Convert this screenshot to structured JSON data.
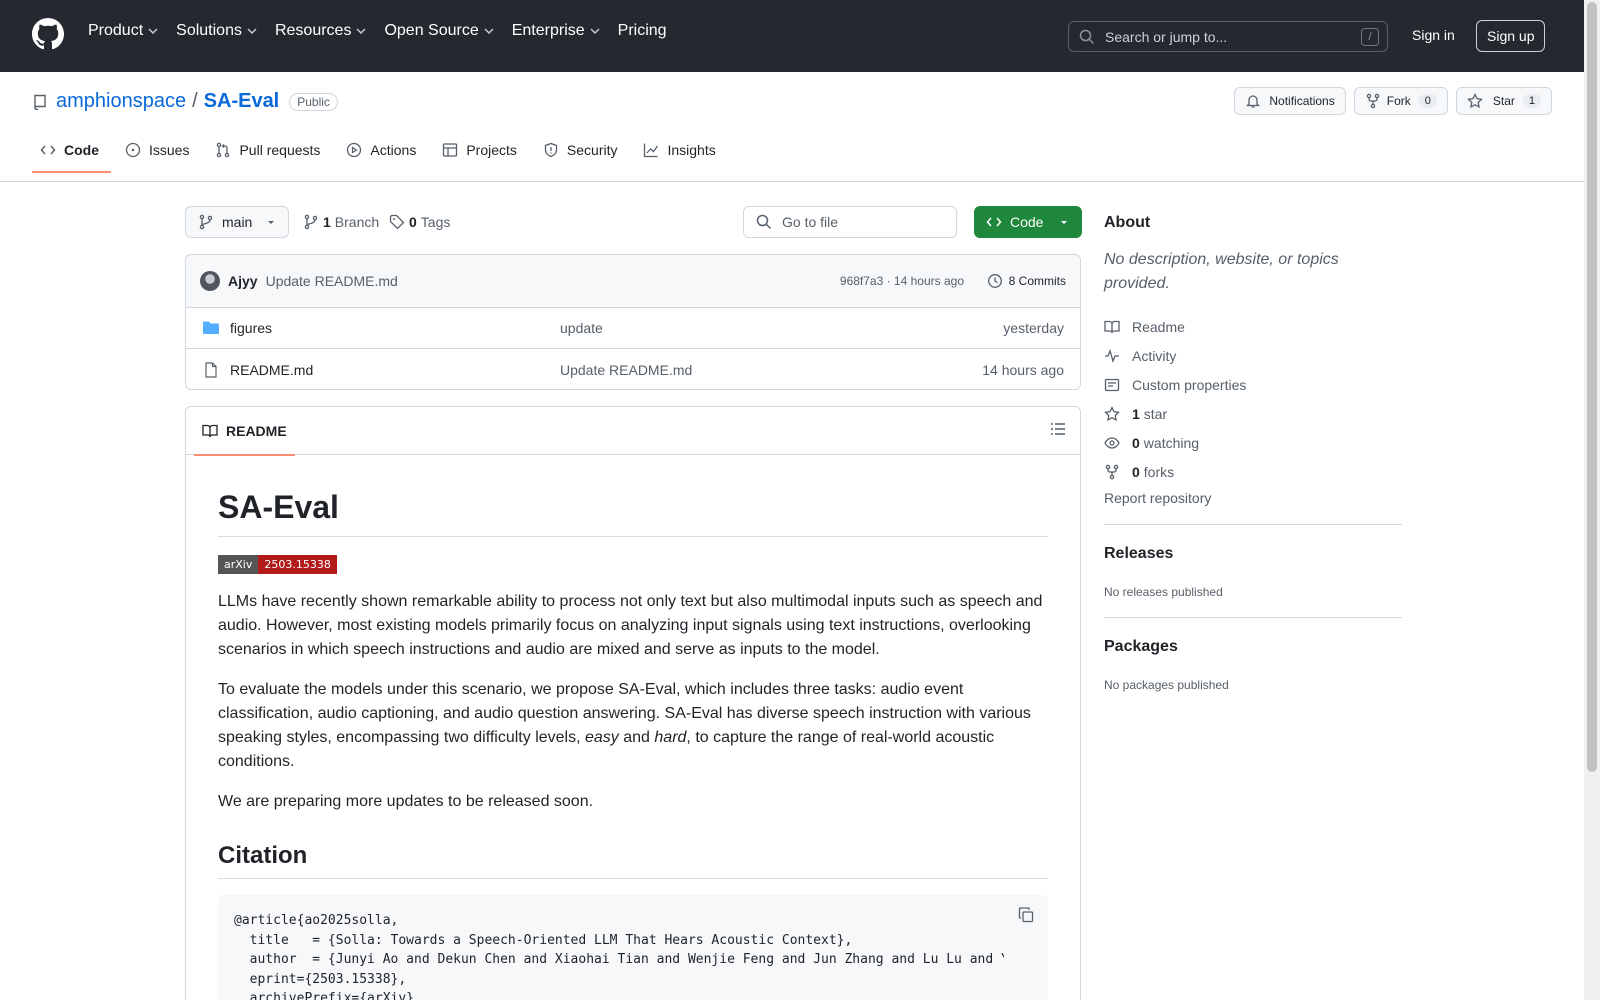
{
  "topnav": {
    "items": [
      "Product",
      "Solutions",
      "Resources",
      "Open Source",
      "Enterprise",
      "Pricing"
    ],
    "search_placeholder": "Search or jump to...",
    "search_shortcut": "/",
    "signin": "Sign in",
    "signup": "Sign up"
  },
  "repo": {
    "owner": "amphionspace",
    "separator": "/",
    "name": "SA-Eval",
    "visibility": "Public",
    "notifications_label": "Notifications",
    "fork_label": "Fork",
    "fork_count": "0",
    "star_label": "Star",
    "star_count": "1"
  },
  "tabs": [
    "Code",
    "Issues",
    "Pull requests",
    "Actions",
    "Projects",
    "Security",
    "Insights"
  ],
  "branchbar": {
    "branch": "main",
    "branch_count": "1",
    "branch_label": "Branch",
    "tag_count": "0",
    "tag_label": "Tags",
    "goto_placeholder": "Go to file",
    "code_button": "Code"
  },
  "commit": {
    "author": "Ajyy",
    "message": "Update README.md",
    "meta": "968f7a3 · 14 hours ago",
    "commits_label": "8 Commits"
  },
  "files": [
    {
      "name": "figures",
      "type": "folder",
      "message": "update",
      "date": "yesterday"
    },
    {
      "name": "README.md",
      "type": "file",
      "message": "Update README.md",
      "date": "14 hours ago"
    }
  ],
  "readme": {
    "tab_label": "README",
    "title": "SA-Eval",
    "badge_left": "arXiv",
    "badge_right": "2503.15338",
    "p1": "LLMs have recently shown remarkable ability to process not only text but also multimodal inputs such as speech and audio. However, most existing models primarily focus on analyzing input signals using text instructions, overlooking scenarios in which speech instructions and audio are mixed and serve as inputs to the model.",
    "p2_a": "To evaluate the models under this scenario, we propose SA-Eval, which includes three tasks: audio event classification, audio captioning, and audio question answering. SA-Eval has diverse speech instruction with various speaking styles, encompassing two difficulty levels, ",
    "p2_easy": "easy",
    "p2_b": " and ",
    "p2_hard": "hard",
    "p2_c": ", to capture the range of real-world acoustic conditions.",
    "p3": "We are preparing more updates to be released soon.",
    "citation_heading": "Citation",
    "code": "@article{ao2025solla,\n  title   = {Solla: Towards a Speech-Oriented LLM That Hears Acoustic Context},\n  author  = {Junyi Ao and Dekun Chen and Xiaohai Tian and Wenjie Feng and Jun Zhang and Lu Lu and Yuxuan Wang and Haizhou Li and Zhizheng Wu},\n  eprint={2503.15338},\n  archivePrefix={arXiv},"
  },
  "sidebar": {
    "about_heading": "About",
    "about_desc": "No description, website, or topics provided.",
    "items": [
      {
        "icon": "book-icon",
        "count": "",
        "label": "Readme"
      },
      {
        "icon": "pulse-icon",
        "count": "",
        "label": "Activity"
      },
      {
        "icon": "note-icon",
        "count": "",
        "label": "Custom properties"
      },
      {
        "icon": "star-icon",
        "count": "1",
        "label": "star"
      },
      {
        "icon": "eye-icon",
        "count": "0",
        "label": "watching"
      },
      {
        "icon": "fork-icon",
        "count": "0",
        "label": "forks"
      }
    ],
    "report": "Report repository",
    "releases_heading": "Releases",
    "releases_text": "No releases published",
    "packages_heading": "Packages",
    "packages_text": "No packages published"
  },
  "colors": {
    "header_bg": "#24292f",
    "link": "#0969da",
    "accent_underline": "#fd8c73",
    "code_button": "#1f883d",
    "arxiv_badge": "#b31b1b"
  }
}
